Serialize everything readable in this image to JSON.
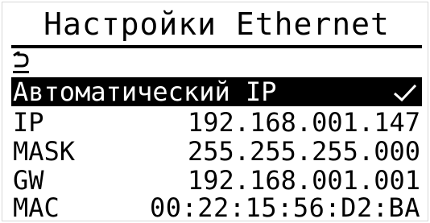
{
  "screen": {
    "title": "Настройки Ethernet",
    "back_icon": "back-arrow-icon",
    "auto_ip": {
      "label": "Автоматический IP",
      "checked": true,
      "check_icon": "checkmark-icon"
    },
    "rows": [
      {
        "label": "IP",
        "value": "192.168.001.147"
      },
      {
        "label": "MASK",
        "value": "255.255.255.000"
      },
      {
        "label": "GW",
        "value": "192.168.001.001"
      },
      {
        "label": "MAC",
        "value": "00:22:15:56:D2:BA"
      }
    ]
  }
}
